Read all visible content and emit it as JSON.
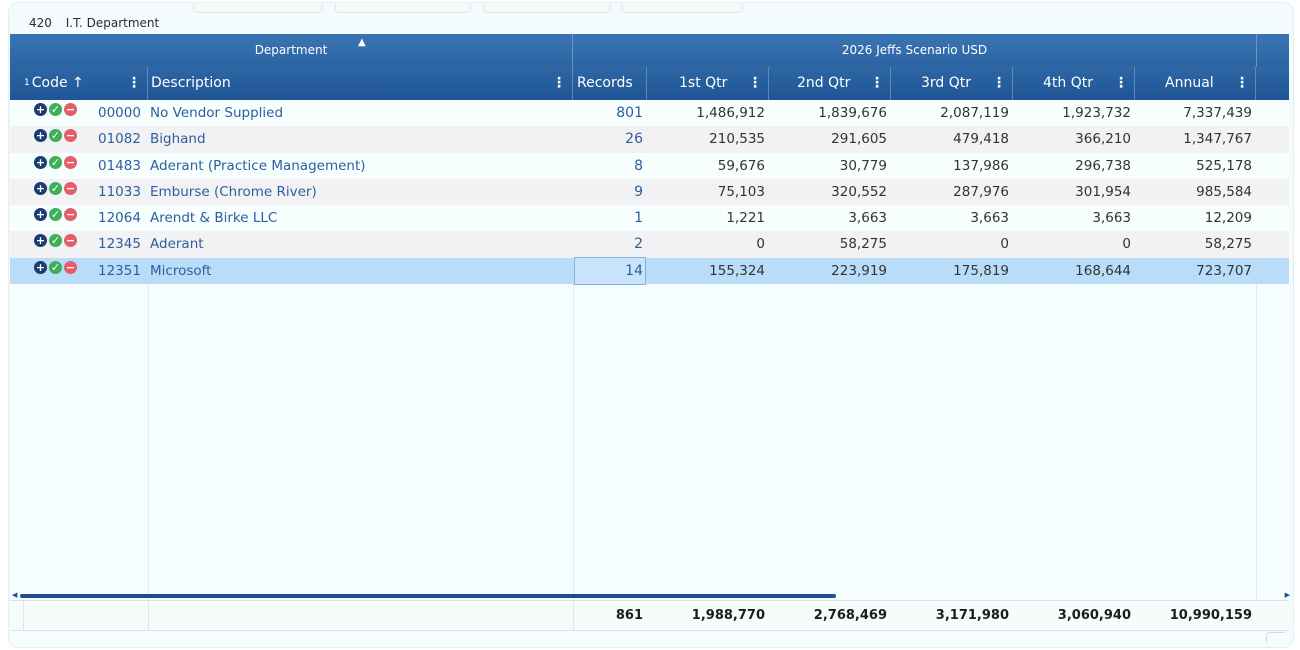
{
  "department": {
    "code": "420",
    "name": "I.T. Department"
  },
  "header_groups": {
    "left": "Department",
    "right": "2026 Jeffs Scenario USD"
  },
  "columns": {
    "sort_index": "1",
    "code": "Code",
    "sort_arrow": "↑",
    "description": "Description",
    "records": "Records",
    "q1": "1st Qtr",
    "q2": "2nd Qtr",
    "q3": "3rd Qtr",
    "q4": "4th Qtr",
    "annual": "Annual",
    "menu_glyph": "⋮"
  },
  "rows": [
    {
      "code": "00000",
      "description": "No Vendor Supplied",
      "records": "801",
      "q1": "1,486,912",
      "q2": "1,839,676",
      "q3": "2,087,119",
      "q4": "1,923,732",
      "annual": "7,337,439"
    },
    {
      "code": "01082",
      "description": "Bighand",
      "records": "26",
      "q1": "210,535",
      "q2": "291,605",
      "q3": "479,418",
      "q4": "366,210",
      "annual": "1,347,767"
    },
    {
      "code": "01483",
      "description": "Aderant (Practice Management)",
      "records": "8",
      "q1": "59,676",
      "q2": "30,779",
      "q3": "137,986",
      "q4": "296,738",
      "annual": "525,178"
    },
    {
      "code": "11033",
      "description": "Emburse (Chrome River)",
      "records": "9",
      "q1": "75,103",
      "q2": "320,552",
      "q3": "287,976",
      "q4": "301,954",
      "annual": "985,584"
    },
    {
      "code": "12064",
      "description": "Arendt & Birke LLC",
      "records": "1",
      "q1": "1,221",
      "q2": "3,663",
      "q3": "3,663",
      "q4": "3,663",
      "annual": "12,209"
    },
    {
      "code": "12345",
      "description": "Aderant",
      "records": "2",
      "q1": "0",
      "q2": "58,275",
      "q3": "0",
      "q4": "0",
      "annual": "58,275"
    },
    {
      "code": "12351",
      "description": "Microsoft",
      "records": "14",
      "q1": "155,324",
      "q2": "223,919",
      "q3": "175,819",
      "q4": "168,644",
      "annual": "723,707"
    }
  ],
  "totals": {
    "records": "861",
    "q1": "1,988,770",
    "q2": "2,768,469",
    "q3": "3,171,980",
    "q4": "3,060,940",
    "annual": "10,990,159"
  },
  "row_icons": {
    "add": "+",
    "approve": "✓",
    "reject": "−"
  },
  "colors": {
    "header_top": "#3a75b3",
    "header_bottom": "#1f5594",
    "selected_row": "#b9dcf9",
    "link_text": "#2d5f9d",
    "approve": "#3fae5a",
    "reject": "#e35e6a"
  }
}
